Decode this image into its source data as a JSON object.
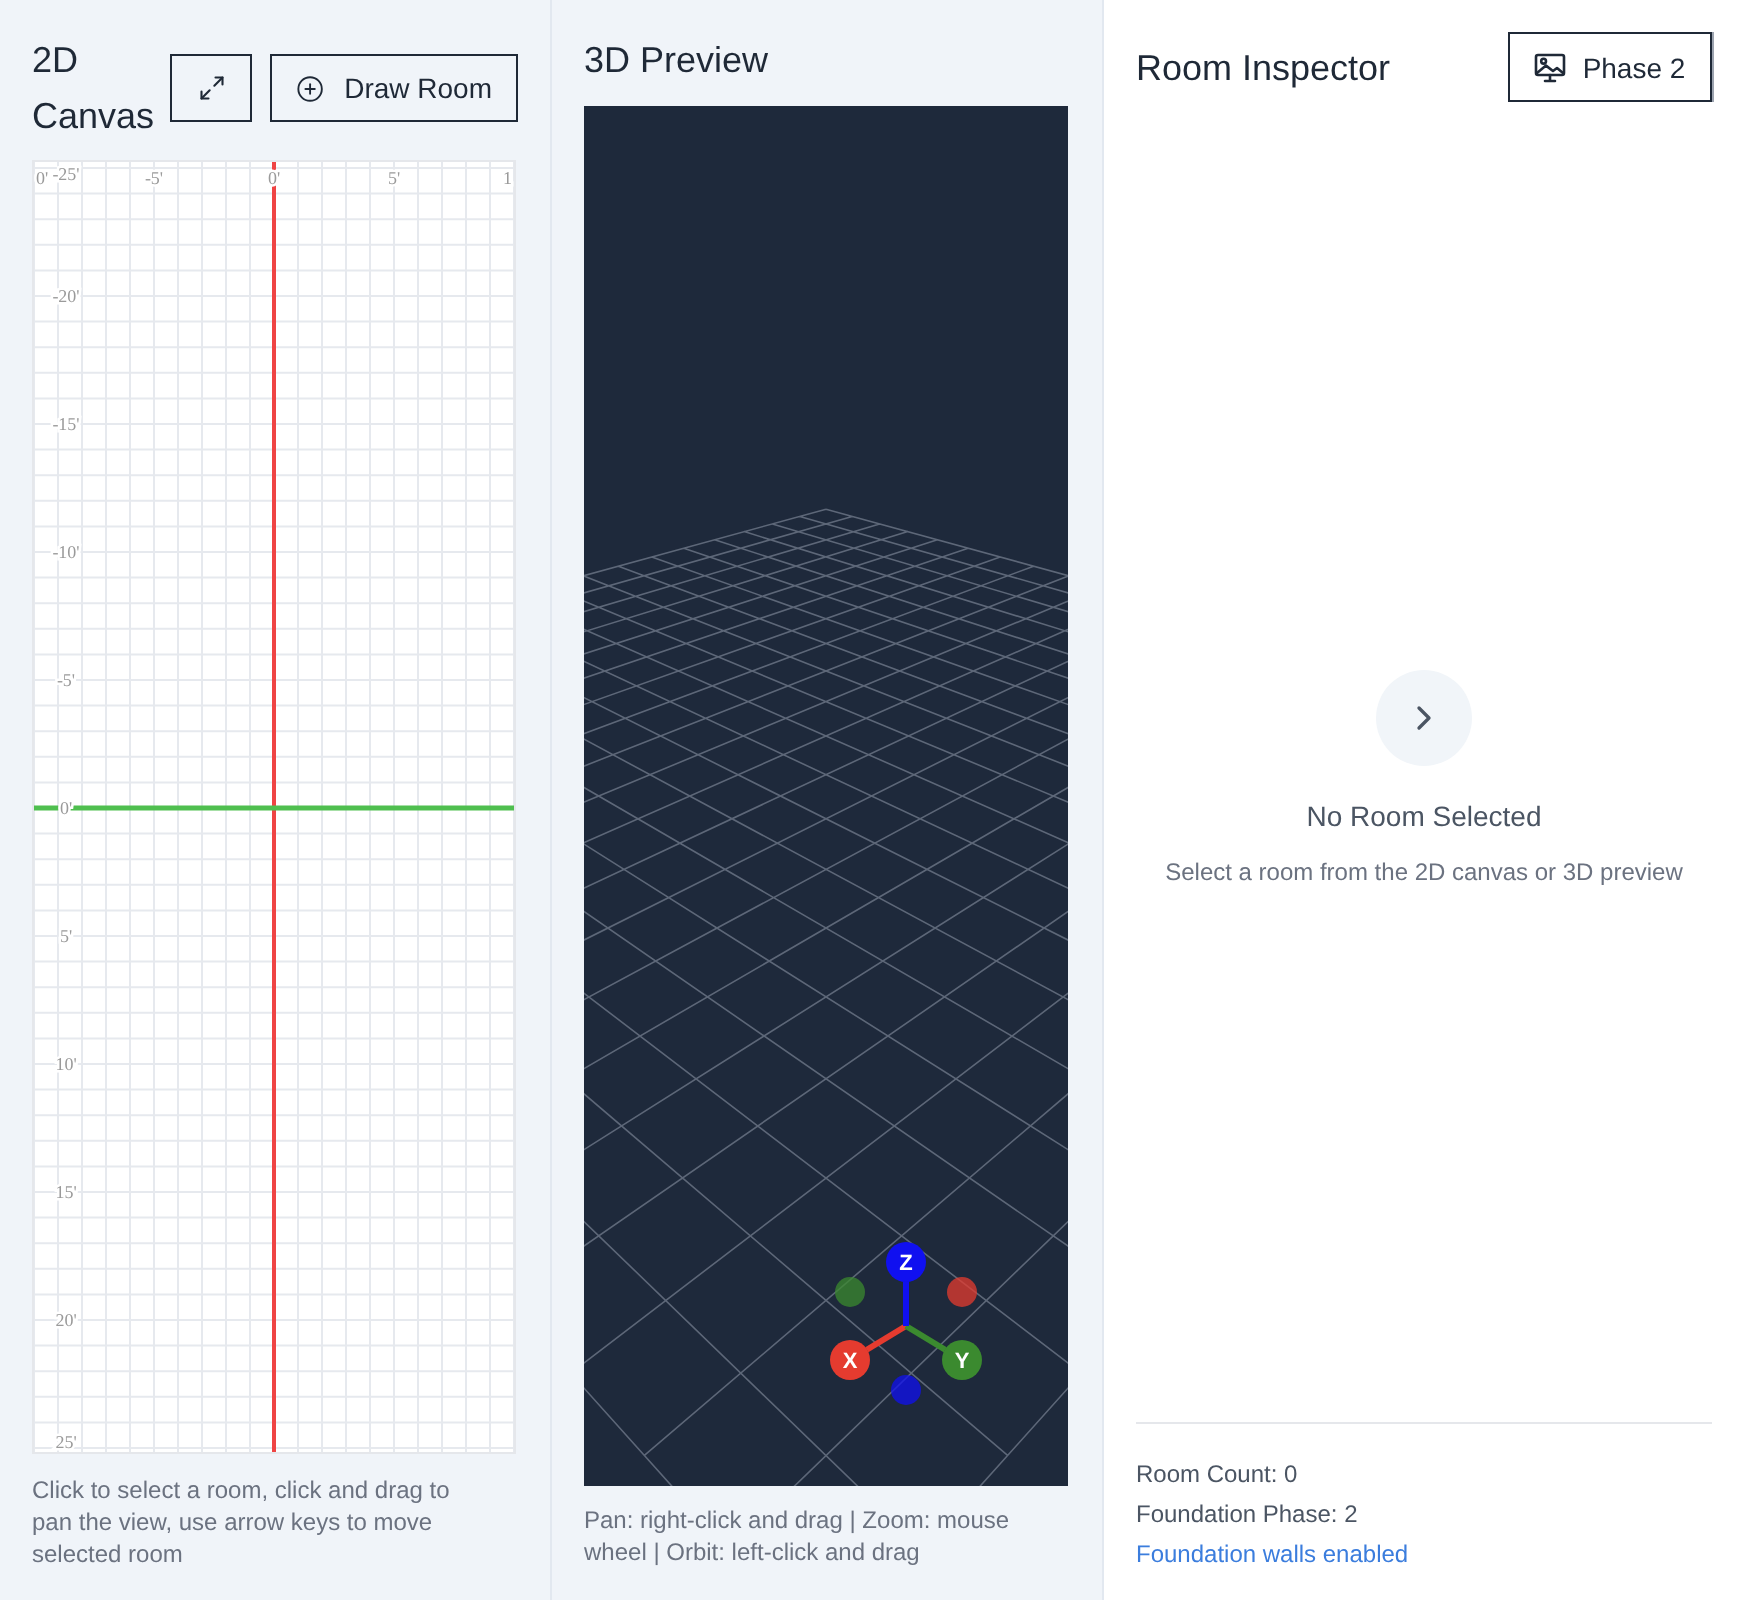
{
  "canvas_panel": {
    "title": "2D Canvas",
    "draw_button": "Draw Room",
    "x_labels": [
      "0'",
      "-5'",
      "0'",
      "5'",
      "1"
    ],
    "y_labels": [
      "-25'",
      "-20'",
      "-15'",
      "-10'",
      "-5'",
      "0'",
      "5'",
      "10'",
      "15'",
      "20'",
      "25'"
    ],
    "hint": "Click to select a room, click and drag to pan the view, use arrow keys to move selected room"
  },
  "preview_panel": {
    "title": "3D Preview",
    "gizmo": {
      "axes": [
        {
          "label": "X",
          "color": "#e53b2f"
        },
        {
          "label": "Y",
          "color": "#3b8a2f"
        },
        {
          "label": "Z",
          "color": "#1010f0"
        }
      ]
    },
    "hint": "Pan: right-click and drag | Zoom: mouse wheel | Orbit: left-click and drag"
  },
  "inspector": {
    "title": "Room Inspector",
    "phase_button": "Phase 2",
    "empty_title": "No Room Selected",
    "empty_text": "Select a room from the 2D canvas or 3D preview",
    "stats": [
      {
        "kind": "stat",
        "text": "Room Count: 0"
      },
      {
        "kind": "stat",
        "text": "Foundation Phase: 2"
      },
      {
        "kind": "status",
        "text": "Foundation walls enabled"
      }
    ]
  }
}
